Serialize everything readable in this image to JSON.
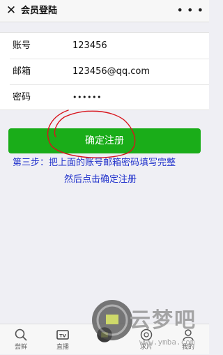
{
  "header": {
    "close_icon": "close-icon",
    "title": "会员登陆",
    "more_icon": "more-dots-icon",
    "more_label": "• • •"
  },
  "form": {
    "rows": [
      {
        "label": "账号",
        "value": "123456"
      },
      {
        "label": "邮箱",
        "value": "123456@qq.com"
      },
      {
        "label": "密码",
        "value": "••••••"
      }
    ]
  },
  "submit_label": "确定注册",
  "annotation": {
    "line1": "第三步：把上面的账号邮箱密码填写完整",
    "line2": "然后点击确定注册",
    "color": "#2233cc",
    "circle_color": "#d8141c"
  },
  "tabs": [
    {
      "label": "尝鲜",
      "icon": "search-icon"
    },
    {
      "label": "直播",
      "icon": "tv-icon"
    },
    {
      "label": "",
      "icon": "center-logo-icon"
    },
    {
      "label": "求片",
      "icon": "request-icon"
    },
    {
      "label": "我的",
      "icon": "user-icon"
    }
  ],
  "watermark": {
    "text": "云梦吧",
    "url": "www.ymba.com"
  },
  "colors": {
    "primary": "#1aad19",
    "background": "#efeff4"
  }
}
